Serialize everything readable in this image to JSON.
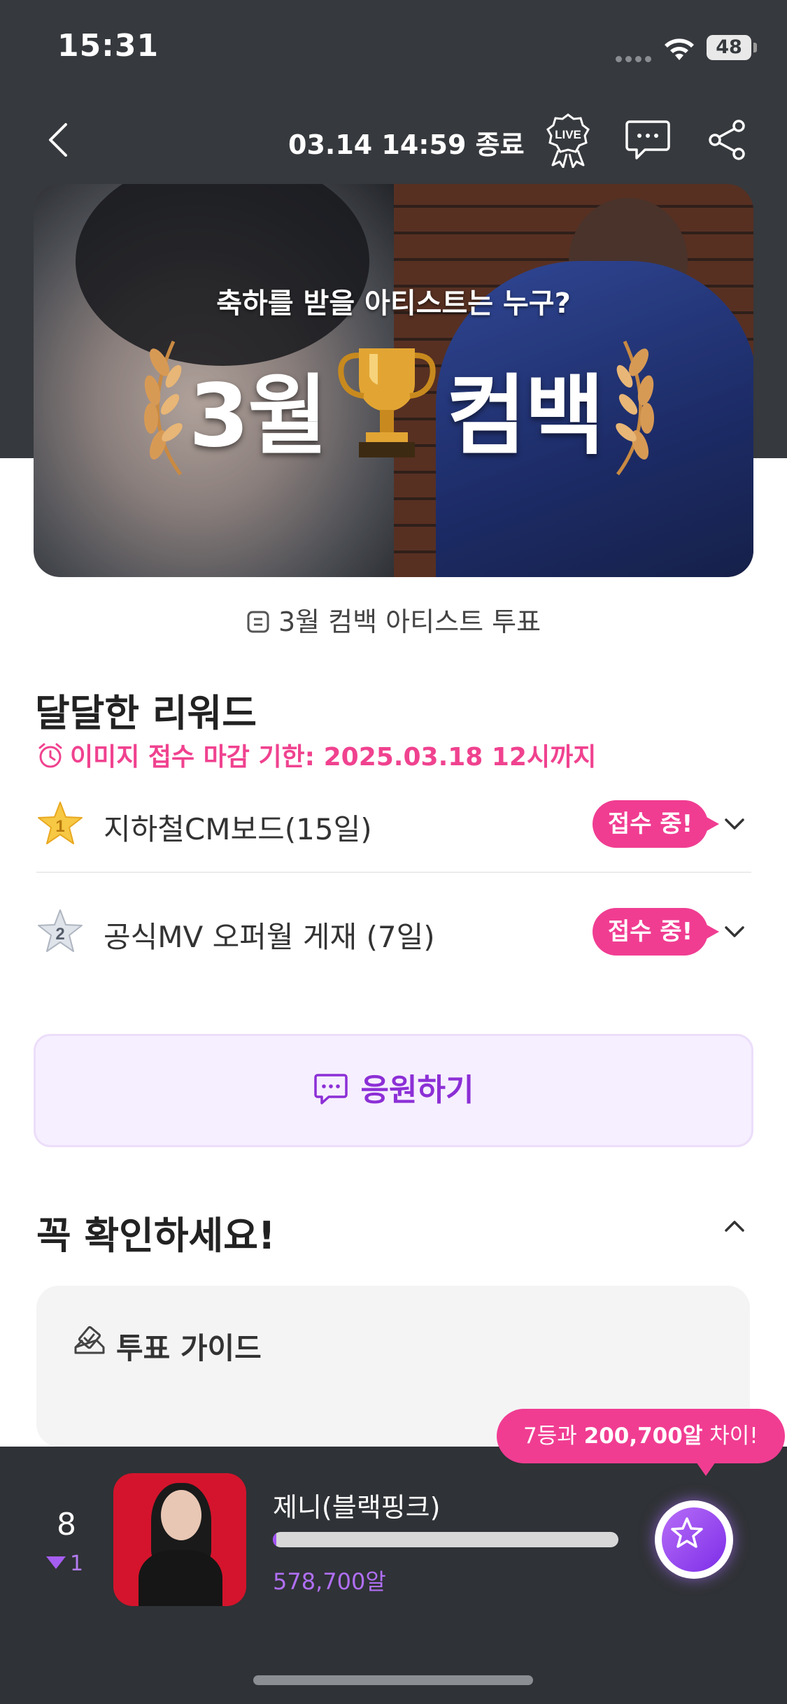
{
  "status_bar": {
    "time": "15:31",
    "battery": "48"
  },
  "nav": {
    "end_time": "03.14 14:59 종료",
    "icons": [
      "back-icon",
      "live-icon",
      "chat-icon",
      "share-icon"
    ]
  },
  "banner": {
    "subtitle": "축하를 받을 아티스트는 누구?",
    "title_left": "3월",
    "title_right": "컴백"
  },
  "vote_link": {
    "label": "3월 컴백 아티스트 투표"
  },
  "rewards": {
    "title": "달달한 리워드",
    "deadline": "이미지 접수 마감 기한: 2025.03.18 12시까지",
    "items": [
      {
        "rank": "1",
        "label": "지하철CM보드(15일)",
        "status": "접수 중!"
      },
      {
        "rank": "2",
        "label": "공식MV 오퍼월 게재 (7일)",
        "status": "접수 중!"
      }
    ]
  },
  "cheer": {
    "label": "응원하기"
  },
  "notice": {
    "title": "꼭 확인하세요!",
    "guide_title": "투표 가이드"
  },
  "bottom": {
    "rank": "8",
    "rank_change": "1",
    "artist_name": "제니(블랙핑크)",
    "votes": "578,700알",
    "progress": 0.01,
    "tooltip_prefix": "7등과 ",
    "tooltip_amount": "200,700알",
    "tooltip_suffix": " 차이!"
  },
  "colors": {
    "accent_pink": "#f03d92",
    "accent_purple": "#8c2fd6",
    "dark_bg": "#36393d"
  }
}
